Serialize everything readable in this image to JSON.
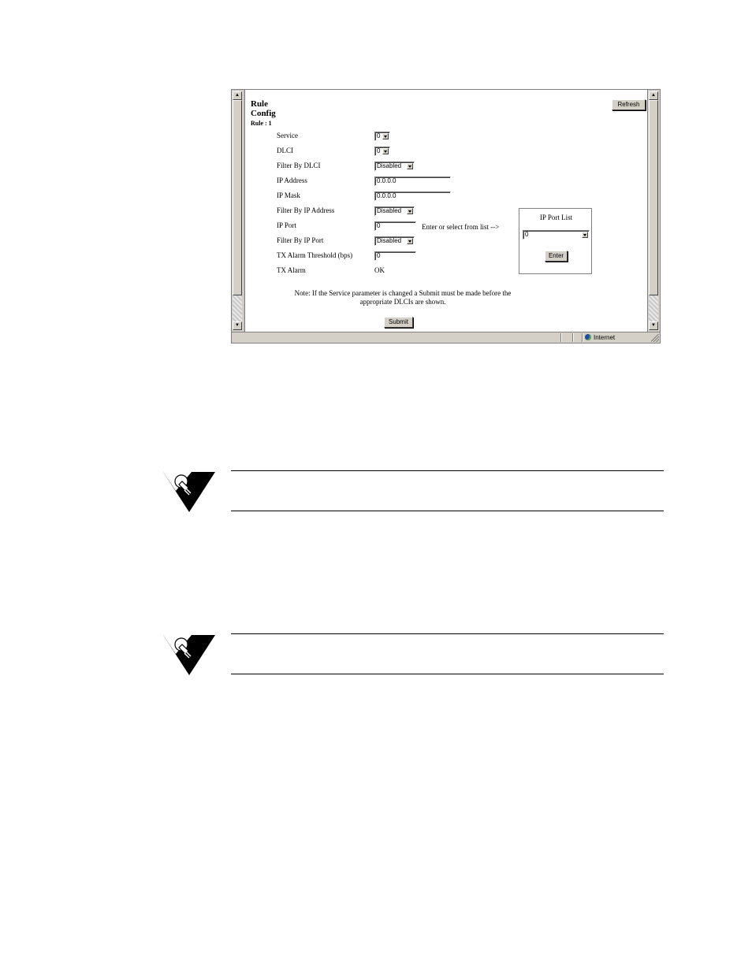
{
  "form": {
    "title_line1": "Rule",
    "title_line2": "Config",
    "rule_label": "Rule : 1",
    "refresh_label": "Refresh",
    "fields": [
      {
        "label": "Service",
        "value": "0"
      },
      {
        "label": "DLCI",
        "value": "0"
      },
      {
        "label": "Filter By DLCI",
        "value": "Disabled"
      },
      {
        "label": "IP Address",
        "value": "0.0.0.0"
      },
      {
        "label": "IP Mask",
        "value": "0.0.0.0"
      },
      {
        "label": "Filter By IP Address",
        "value": "Disabled"
      },
      {
        "label": "IP Port",
        "value": "0"
      },
      {
        "label": "Filter By IP Port",
        "value": "Disabled"
      },
      {
        "label": "TX Alarm Threshold (bps)",
        "value": "0"
      },
      {
        "label": "TX Alarm",
        "value": "OK"
      }
    ],
    "port_hint": "Enter or select from list -->",
    "port_list": {
      "title": "IP Port List",
      "selected": "0",
      "enter_label": "Enter"
    },
    "note_line1": "Note:  If the Service parameter is changed a Submit must be made before the",
    "note_line2": "appropriate DLCIs are shown.",
    "submit_label": "Submit"
  },
  "statusbar": {
    "zone": "Internet"
  },
  "icons": {
    "tip": "lightbulb-icon"
  }
}
